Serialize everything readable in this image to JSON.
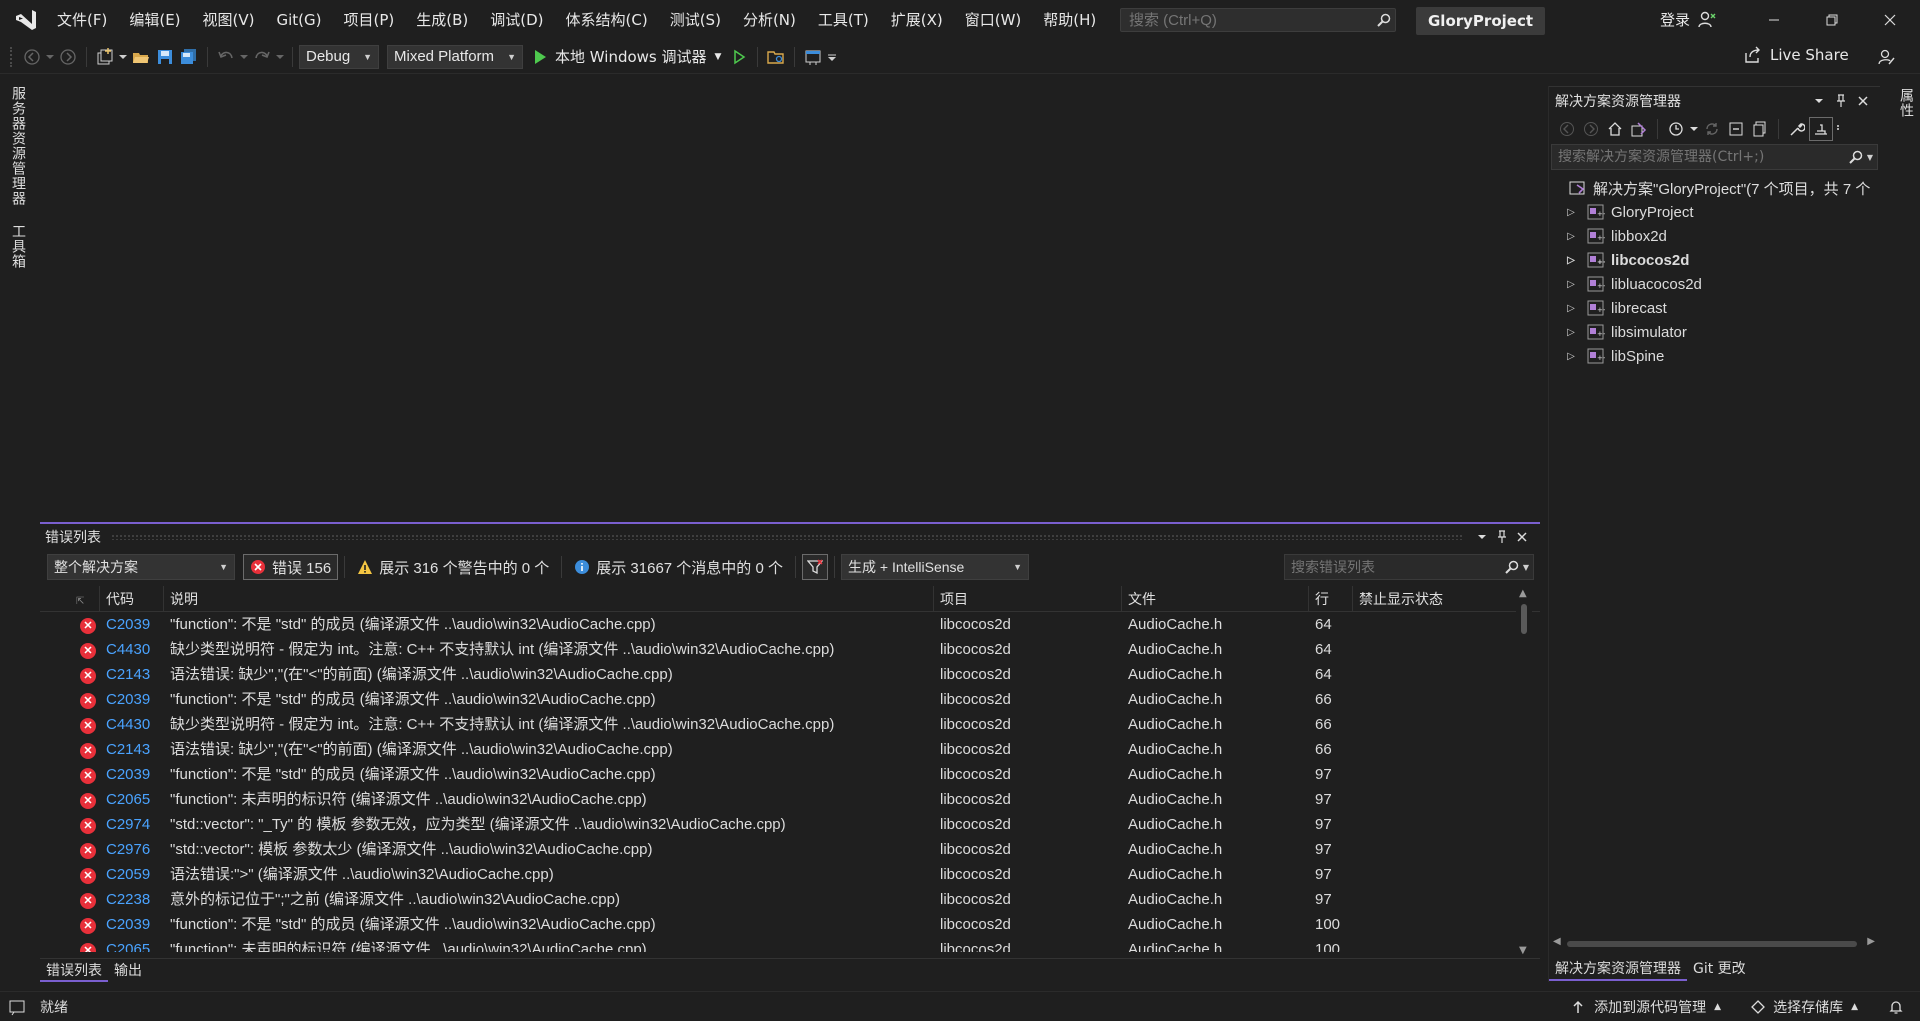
{
  "menu": {
    "items": [
      "文件(F)",
      "编辑(E)",
      "视图(V)",
      "Git(G)",
      "项目(P)",
      "生成(B)",
      "调试(D)",
      "体系结构(C)",
      "测试(S)",
      "分析(N)",
      "工具(T)",
      "扩展(X)",
      "窗口(W)",
      "帮助(H)"
    ],
    "search_placeholder": "搜索 (Ctrl+Q)",
    "project_name": "GloryProject",
    "login": "登录"
  },
  "toolbar": {
    "config": "Debug",
    "platform": "Mixed Platform",
    "run_label": "本地 Windows 调试器",
    "live_share": "Live Share"
  },
  "left_tabs": [
    "服务器资源管理器",
    "工具箱"
  ],
  "right_tabs": [
    "属性"
  ],
  "error_list": {
    "title": "错误列表",
    "scope": "整个解决方案",
    "errors_label": "错误 156",
    "warnings_label": "展示 316 个警告中的 0 个",
    "messages_label": "展示 31667 个消息中的 0 个",
    "build_filter": "生成 + IntelliSense",
    "search_placeholder": "搜索错误列表",
    "columns": {
      "code": "代码",
      "desc": "说明",
      "project": "项目",
      "file": "文件",
      "line": "行",
      "suppress": "禁止显示状态"
    },
    "rows": [
      {
        "code": "C2039",
        "desc": "\"function\": 不是 \"std\" 的成员 (编译源文件 ..\\audio\\win32\\AudioCache.cpp)",
        "project": "libcocos2d",
        "file": "AudioCache.h",
        "line": "64"
      },
      {
        "code": "C4430",
        "desc": "缺少类型说明符 - 假定为 int。注意: C++ 不支持默认 int (编译源文件 ..\\audio\\win32\\AudioCache.cpp)",
        "project": "libcocos2d",
        "file": "AudioCache.h",
        "line": "64"
      },
      {
        "code": "C2143",
        "desc": "语法错误: 缺少\",\"(在\"<\"的前面) (编译源文件 ..\\audio\\win32\\AudioCache.cpp)",
        "project": "libcocos2d",
        "file": "AudioCache.h",
        "line": "64"
      },
      {
        "code": "C2039",
        "desc": "\"function\": 不是 \"std\" 的成员 (编译源文件 ..\\audio\\win32\\AudioCache.cpp)",
        "project": "libcocos2d",
        "file": "AudioCache.h",
        "line": "66"
      },
      {
        "code": "C4430",
        "desc": "缺少类型说明符 - 假定为 int。注意: C++ 不支持默认 int (编译源文件 ..\\audio\\win32\\AudioCache.cpp)",
        "project": "libcocos2d",
        "file": "AudioCache.h",
        "line": "66"
      },
      {
        "code": "C2143",
        "desc": "语法错误: 缺少\",\"(在\"<\"的前面) (编译源文件 ..\\audio\\win32\\AudioCache.cpp)",
        "project": "libcocos2d",
        "file": "AudioCache.h",
        "line": "66"
      },
      {
        "code": "C2039",
        "desc": "\"function\": 不是 \"std\" 的成员 (编译源文件 ..\\audio\\win32\\AudioCache.cpp)",
        "project": "libcocos2d",
        "file": "AudioCache.h",
        "line": "97"
      },
      {
        "code": "C2065",
        "desc": "\"function\": 未声明的标识符 (编译源文件 ..\\audio\\win32\\AudioCache.cpp)",
        "project": "libcocos2d",
        "file": "AudioCache.h",
        "line": "97"
      },
      {
        "code": "C2974",
        "desc": "\"std::vector\": \"_Ty\" 的 模板 参数无效，应为类型 (编译源文件 ..\\audio\\win32\\AudioCache.cpp)",
        "project": "libcocos2d",
        "file": "AudioCache.h",
        "line": "97"
      },
      {
        "code": "C2976",
        "desc": "\"std::vector\": 模板 参数太少 (编译源文件 ..\\audio\\win32\\AudioCache.cpp)",
        "project": "libcocos2d",
        "file": "AudioCache.h",
        "line": "97"
      },
      {
        "code": "C2059",
        "desc": "语法错误:\">\" (编译源文件 ..\\audio\\win32\\AudioCache.cpp)",
        "project": "libcocos2d",
        "file": "AudioCache.h",
        "line": "97"
      },
      {
        "code": "C2238",
        "desc": "意外的标记位于\";\"之前 (编译源文件 ..\\audio\\win32\\AudioCache.cpp)",
        "project": "libcocos2d",
        "file": "AudioCache.h",
        "line": "97"
      },
      {
        "code": "C2039",
        "desc": "\"function\": 不是 \"std\" 的成员 (编译源文件 ..\\audio\\win32\\AudioCache.cpp)",
        "project": "libcocos2d",
        "file": "AudioCache.h",
        "line": "100"
      },
      {
        "code": "C2065",
        "desc": "\"function\": 未声明的标识符 (编译源文件 ..\\audio\\win32\\AudioCache.cpp)",
        "project": "libcocos2d",
        "file": "AudioCache.h",
        "line": "100"
      }
    ],
    "tabs": [
      "错误列表",
      "输出"
    ]
  },
  "solution_explorer": {
    "title": "解决方案资源管理器",
    "search_placeholder": "搜索解决方案资源管理器(Ctrl+;)",
    "root": "解决方案\"GloryProject\"(7 个项目，共 7 个",
    "projects": [
      "GloryProject",
      "libbox2d",
      "libcocos2d",
      "libluacocos2d",
      "librecast",
      "libsimulator",
      "libSpine"
    ],
    "bold_project": "libcocos2d",
    "tabs": [
      "解决方案资源管理器",
      "Git 更改"
    ]
  },
  "status": {
    "ready": "就绪",
    "add_source_control": "添加到源代码管理",
    "select_repo": "选择存储库"
  },
  "colors": {
    "accent": "#7a5fcf",
    "error": "#e8303a",
    "code_link": "#4aa3ff",
    "run_green": "#4ec94e"
  }
}
